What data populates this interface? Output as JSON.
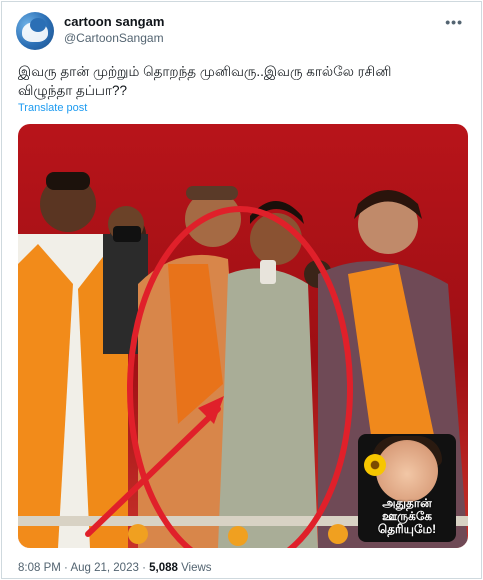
{
  "account": {
    "display_name": "cartoon sangam",
    "handle": "@CartoonSangam"
  },
  "more_icon": "more-dots-icon",
  "tweet": {
    "text_line1": "இவரு தான் முற்றும் தொறந்த முனிவரு..இவரு கால்லே ரசினி",
    "text_line2": "விழுந்தா தப்பா??",
    "translate_label": "Translate post"
  },
  "media": {
    "sticker_text_line1": "அதுதான்",
    "sticker_text_line2": "ஊருக்கே",
    "sticker_text_line3": "தெரியுமே!",
    "highlight_color": "#e0202a"
  },
  "meta": {
    "time": "8:08 PM",
    "separator": "·",
    "date": "Aug 21, 2023",
    "views_count": "5,088",
    "views_label": "Views"
  }
}
